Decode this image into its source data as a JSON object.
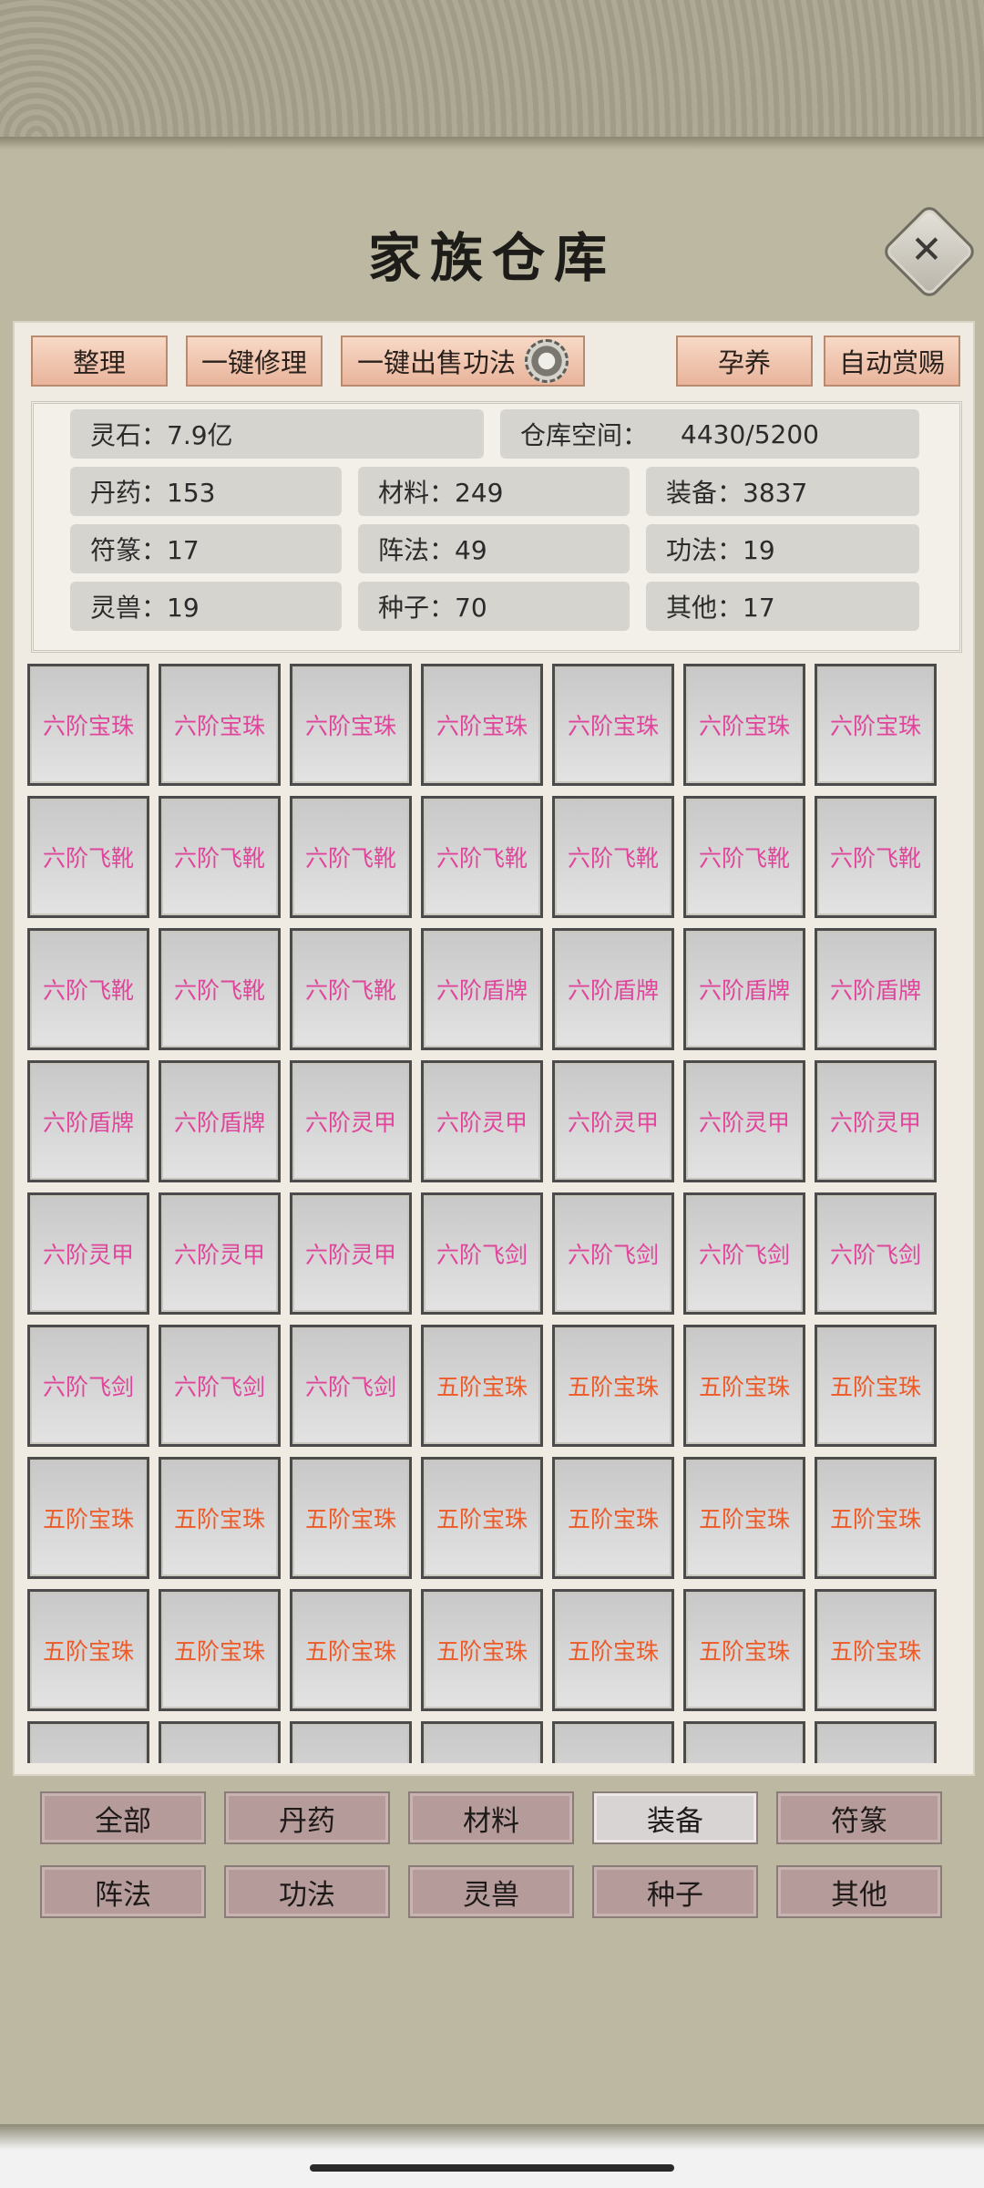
{
  "title": "家族仓库",
  "top_buttons": {
    "arrange": "整理",
    "repair": "一键修理",
    "sell_skills": "一键出售功法",
    "nurture": "孕养",
    "auto_reward": "自动赏赐"
  },
  "stats": {
    "spirit_stone": "灵石：7.9亿",
    "storage_label": "仓库空间：",
    "storage_value": "4430/5200",
    "pills": "丹药：153",
    "materials": "材料：249",
    "equipment": "装备：3837",
    "talismans": "符篆：17",
    "formations": "阵法：49",
    "skills": "功法：19",
    "beasts": "灵兽：19",
    "seeds": "种子：70",
    "others": "其他：17"
  },
  "colors": {
    "tier6": "#e0459b",
    "tier5": "#ee5a27"
  },
  "items": [
    {
      "name": "六阶宝珠",
      "tier": 6
    },
    {
      "name": "六阶宝珠",
      "tier": 6
    },
    {
      "name": "六阶宝珠",
      "tier": 6
    },
    {
      "name": "六阶宝珠",
      "tier": 6
    },
    {
      "name": "六阶宝珠",
      "tier": 6
    },
    {
      "name": "六阶宝珠",
      "tier": 6
    },
    {
      "name": "六阶宝珠",
      "tier": 6
    },
    {
      "name": "六阶飞靴",
      "tier": 6
    },
    {
      "name": "六阶飞靴",
      "tier": 6
    },
    {
      "name": "六阶飞靴",
      "tier": 6
    },
    {
      "name": "六阶飞靴",
      "tier": 6
    },
    {
      "name": "六阶飞靴",
      "tier": 6
    },
    {
      "name": "六阶飞靴",
      "tier": 6
    },
    {
      "name": "六阶飞靴",
      "tier": 6
    },
    {
      "name": "六阶飞靴",
      "tier": 6
    },
    {
      "name": "六阶飞靴",
      "tier": 6
    },
    {
      "name": "六阶飞靴",
      "tier": 6
    },
    {
      "name": "六阶盾牌",
      "tier": 6
    },
    {
      "name": "六阶盾牌",
      "tier": 6
    },
    {
      "name": "六阶盾牌",
      "tier": 6
    },
    {
      "name": "六阶盾牌",
      "tier": 6
    },
    {
      "name": "六阶盾牌",
      "tier": 6
    },
    {
      "name": "六阶盾牌",
      "tier": 6
    },
    {
      "name": "六阶灵甲",
      "tier": 6
    },
    {
      "name": "六阶灵甲",
      "tier": 6
    },
    {
      "name": "六阶灵甲",
      "tier": 6
    },
    {
      "name": "六阶灵甲",
      "tier": 6
    },
    {
      "name": "六阶灵甲",
      "tier": 6
    },
    {
      "name": "六阶灵甲",
      "tier": 6
    },
    {
      "name": "六阶灵甲",
      "tier": 6
    },
    {
      "name": "六阶灵甲",
      "tier": 6
    },
    {
      "name": "六阶飞剑",
      "tier": 6
    },
    {
      "name": "六阶飞剑",
      "tier": 6
    },
    {
      "name": "六阶飞剑",
      "tier": 6
    },
    {
      "name": "六阶飞剑",
      "tier": 6
    },
    {
      "name": "六阶飞剑",
      "tier": 6
    },
    {
      "name": "六阶飞剑",
      "tier": 6
    },
    {
      "name": "六阶飞剑",
      "tier": 6
    },
    {
      "name": "五阶宝珠",
      "tier": 5
    },
    {
      "name": "五阶宝珠",
      "tier": 5
    },
    {
      "name": "五阶宝珠",
      "tier": 5
    },
    {
      "name": "五阶宝珠",
      "tier": 5
    },
    {
      "name": "五阶宝珠",
      "tier": 5
    },
    {
      "name": "五阶宝珠",
      "tier": 5
    },
    {
      "name": "五阶宝珠",
      "tier": 5
    },
    {
      "name": "五阶宝珠",
      "tier": 5
    },
    {
      "name": "五阶宝珠",
      "tier": 5
    },
    {
      "name": "五阶宝珠",
      "tier": 5
    },
    {
      "name": "五阶宝珠",
      "tier": 5
    },
    {
      "name": "五阶宝珠",
      "tier": 5
    },
    {
      "name": "五阶宝珠",
      "tier": 5
    },
    {
      "name": "五阶宝珠",
      "tier": 5
    },
    {
      "name": "五阶宝珠",
      "tier": 5
    },
    {
      "name": "五阶宝珠",
      "tier": 5
    },
    {
      "name": "五阶宝珠",
      "tier": 5
    },
    {
      "name": "五阶宝珠",
      "tier": 5
    },
    {
      "name": "",
      "tier": 0
    },
    {
      "name": "",
      "tier": 0
    },
    {
      "name": "",
      "tier": 0
    },
    {
      "name": "",
      "tier": 0
    },
    {
      "name": "",
      "tier": 0
    },
    {
      "name": "",
      "tier": 0
    },
    {
      "name": "",
      "tier": 0
    }
  ],
  "categories": [
    {
      "label": "全部",
      "active": false
    },
    {
      "label": "丹药",
      "active": false
    },
    {
      "label": "材料",
      "active": false
    },
    {
      "label": "装备",
      "active": true
    },
    {
      "label": "符篆",
      "active": false
    },
    {
      "label": "阵法",
      "active": false
    },
    {
      "label": "功法",
      "active": false
    },
    {
      "label": "灵兽",
      "active": false
    },
    {
      "label": "种子",
      "active": false
    },
    {
      "label": "其他",
      "active": false
    }
  ]
}
